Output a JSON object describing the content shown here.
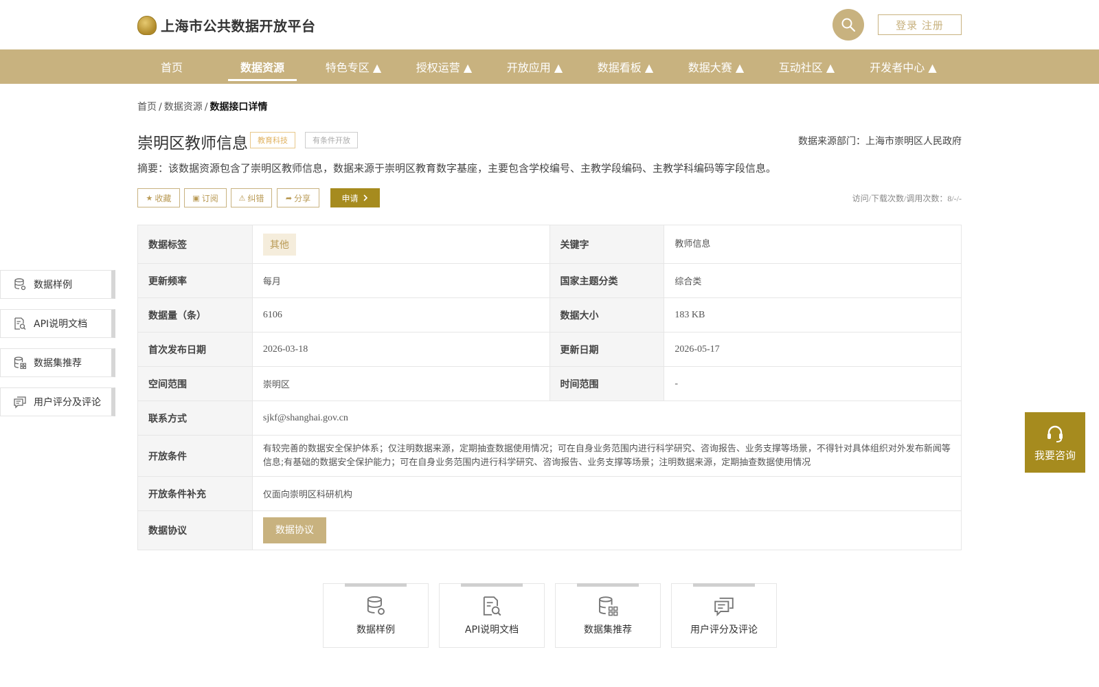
{
  "header": {
    "site_title": "上海市公共数据开放平台",
    "login_label": "登录 注册"
  },
  "nav": {
    "items": [
      {
        "label": "首页"
      },
      {
        "label": "数据资源"
      },
      {
        "label": "特色专区 ▲"
      },
      {
        "label": "授权运营 ▲"
      },
      {
        "label": "开放应用 ▲"
      },
      {
        "label": "数据看板 ▲"
      },
      {
        "label": "数据大赛 ▲"
      },
      {
        "label": "互动社区 ▲"
      },
      {
        "label": "开发者中心 ▲"
      }
    ],
    "active_index": 1
  },
  "breadcrumb": {
    "home": "首页",
    "section": "数据资源",
    "current": "数据接口详情",
    "separator": "/"
  },
  "dataset": {
    "title": "崇明区教师信息",
    "tag_category": "教育科技",
    "tag_open": "有条件开放",
    "source_dept": "数据来源部门：上海市崇明区人民政府",
    "summary": "摘要：该数据资源包含了崇明区教师信息，数据来源于崇明区教育数字基座，主要包含学校编号、主教学段编码、主教学科编码等字段信息。",
    "visits": "访问/下载次数/调用次数：8/-/-"
  },
  "actions": {
    "favorite": "收藏",
    "subscribe": "订阅",
    "correct": "纠错",
    "share": "分享",
    "apply": "申请"
  },
  "table": {
    "data_tag_k": "数据标签",
    "data_tag_v": "其他",
    "keyword_k": "关键字",
    "keyword_v": "教师信息",
    "freq_k": "更新频率",
    "freq_v": "每月",
    "theme_k": "国家主题分类",
    "theme_v": "综合类",
    "count_k": "数据量（条）",
    "count_v": "6106",
    "size_k": "数据大小",
    "size_v": "183 KB",
    "first_pub_k": "首次发布日期",
    "first_pub_v": "2026-03-18",
    "updated_k": "更新日期",
    "updated_v": "2026-05-17",
    "space_k": "空间范围",
    "space_v": "崇明区",
    "time_k": "时间范围",
    "time_v": "-",
    "contact_k": "联系方式",
    "contact_v": "sjkf@shanghai.gov.cn",
    "open_cond_k": "开放条件",
    "open_cond_v": "有较完善的数据安全保护体系；仅注明数据来源，定期抽查数据使用情况；可在自身业务范围内进行科学研究、咨询报告、业务支撑等场景，不得针对具体组织对外发布新闻等信息;有基础的数据安全保护能力；可在自身业务范围内进行科学研究、咨询报告、业务支撑等场景；注明数据来源，定期抽查数据使用情况",
    "open_supp_k": "开放条件补充",
    "open_supp_v": "仅面向崇明区科研机构",
    "agreement_k": "数据协议",
    "agreement_btn": "数据协议"
  },
  "side_nav": {
    "items": [
      {
        "label": "数据样例",
        "icon": "database-gear-icon"
      },
      {
        "label": "API说明文档",
        "icon": "document-search-icon"
      },
      {
        "label": "数据集推荐",
        "icon": "database-grid-icon"
      },
      {
        "label": "用户评分及评论",
        "icon": "comments-icon"
      }
    ]
  },
  "consult": {
    "label": "我要咨询",
    "icon": "headset-icon"
  },
  "bottom_cards": {
    "items": [
      {
        "label": "数据样例",
        "icon": "database-gear-icon"
      },
      {
        "label": "API说明文档",
        "icon": "document-search-icon"
      },
      {
        "label": "数据集推荐",
        "icon": "database-grid-icon"
      },
      {
        "label": "用户评分及评论",
        "icon": "comments-icon"
      }
    ]
  },
  "colors": {
    "brand": "#c8b27f",
    "brand_dark": "#a68b1e",
    "tag_gold": "#e0b260"
  }
}
